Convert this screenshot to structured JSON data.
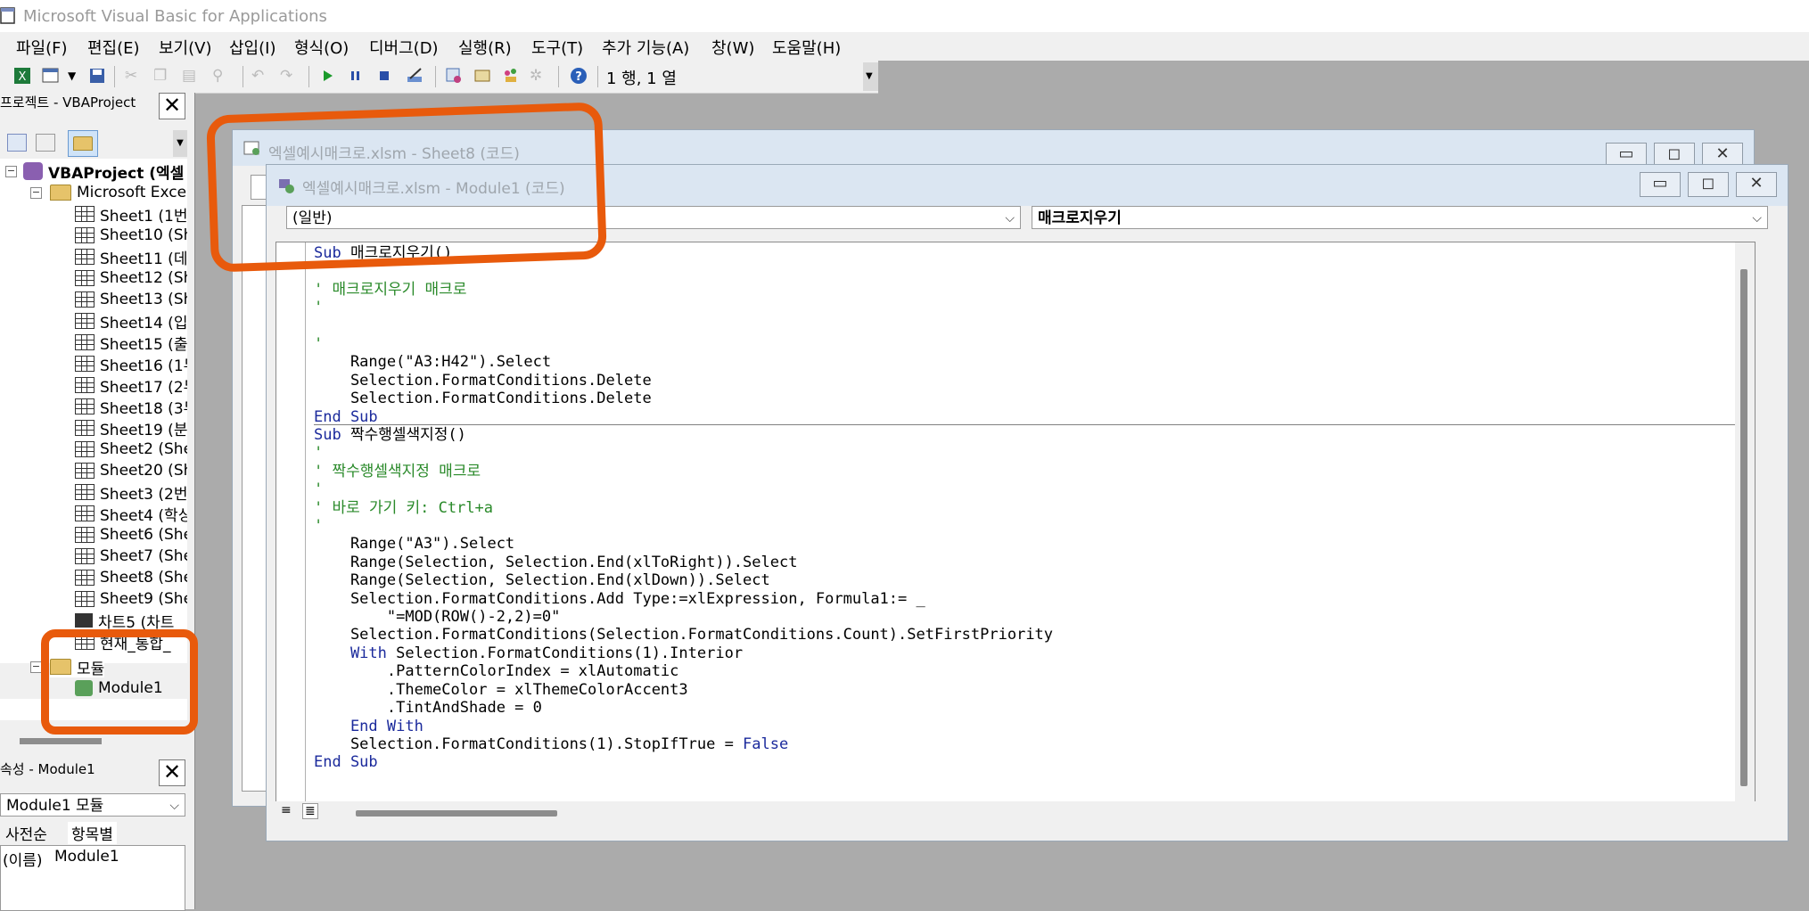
{
  "window": {
    "title": "Microsoft Visual Basic for Applications"
  },
  "menu": [
    "파일(F)",
    "편집(E)",
    "보기(V)",
    "삽입(I)",
    "형식(O)",
    "디버그(D)",
    "실행(R)",
    "도구(T)",
    "추가 기능(A)",
    "창(W)",
    "도움말(H)"
  ],
  "toolbar": {
    "cursor_position": "1 행, 1 열"
  },
  "project": {
    "title": "프로젝트 - VBAProject",
    "root": "VBAProject (엑셀",
    "excel_objects": "Microsoft Excel",
    "sheets": [
      "Sheet1 (1번",
      "Sheet10 (Sh",
      "Sheet11 (데",
      "Sheet12 (Sh",
      "Sheet13 (Sh",
      "Sheet14 (입",
      "Sheet15 (출",
      "Sheet16 (1두",
      "Sheet17 (2두",
      "Sheet18 (3두",
      "Sheet19 (분",
      "Sheet2 (She",
      "Sheet20 (Sh",
      "Sheet3 (2번",
      "Sheet4 (학싱",
      "Sheet6 (She",
      "Sheet7 (She",
      "Sheet8 (She",
      "Sheet9 (She"
    ],
    "chart": "차트5 (차트",
    "workbook": "현재_통합_",
    "modules_folder": "모듈",
    "module": "Module1"
  },
  "properties": {
    "title": "속성 - Module1",
    "object": "Module1 모듈",
    "tab_alpha": "사전순",
    "tab_category": "항목별",
    "name_key": "(이름)",
    "name_value": "Module1"
  },
  "back_window": {
    "title": "엑셀예시매크로.xlsm - Sheet8 (코드)"
  },
  "front_window": {
    "title": "엑셀예시매크로.xlsm - Module1 (코드)",
    "object_combo": "(일반)",
    "proc_combo": "매크로지우기"
  },
  "code": {
    "sub1": [
      {
        "k": "Sub ",
        "t": "매크로지우기()"
      },
      {
        "c": "'"
      },
      {
        "c": "' 매크로지우기 매크로"
      },
      {
        "c": "'"
      },
      {
        "c": ""
      },
      {
        "c": "'"
      },
      {
        "t": "    Range(\"A3:H42\").Select"
      },
      {
        "t": "    Selection.FormatConditions.Delete"
      },
      {
        "t": "    Selection.FormatConditions.Delete"
      },
      {
        "k": "End Sub",
        "t": ""
      }
    ],
    "sub2": [
      {
        "k": "Sub ",
        "t": "짝수행셀색지정()"
      },
      {
        "c": "'"
      },
      {
        "c": "' 짝수행셀색지정 매크로"
      },
      {
        "c": "'"
      },
      {
        "c": "' 바로 가기 키: Ctrl+a"
      },
      {
        "c": "'"
      },
      {
        "t": "    Range(\"A3\").Select"
      },
      {
        "t": "    Range(Selection, Selection.End(xlToRight)).Select"
      },
      {
        "t": "    Range(Selection, Selection.End(xlDown)).Select"
      },
      {
        "t": "    Selection.FormatConditions.Add Type:=xlExpression, Formula1:= _"
      },
      {
        "t": "        \"=MOD(ROW()-2,2)=0\""
      },
      {
        "t": "    Selection.FormatConditions(Selection.FormatConditions.Count).SetFirstPriority"
      },
      {
        "k": "    With ",
        "t": "Selection.FormatConditions(1).Interior"
      },
      {
        "t": "        .PatternColorIndex = xlAutomatic"
      },
      {
        "t": "        .ThemeColor = xlThemeColorAccent3"
      },
      {
        "t": "        .TintAndShade = 0"
      },
      {
        "k": "    End With",
        "t": ""
      },
      {
        "t": "    Selection.FormatConditions(1).StopIfTrue = ",
        "k2": "False"
      },
      {
        "k": "End Sub",
        "t": ""
      }
    ]
  },
  "colors": {
    "annotation": "#e85a0c",
    "keyword": "#1b2a9c",
    "comment": "#2a8a2a"
  }
}
